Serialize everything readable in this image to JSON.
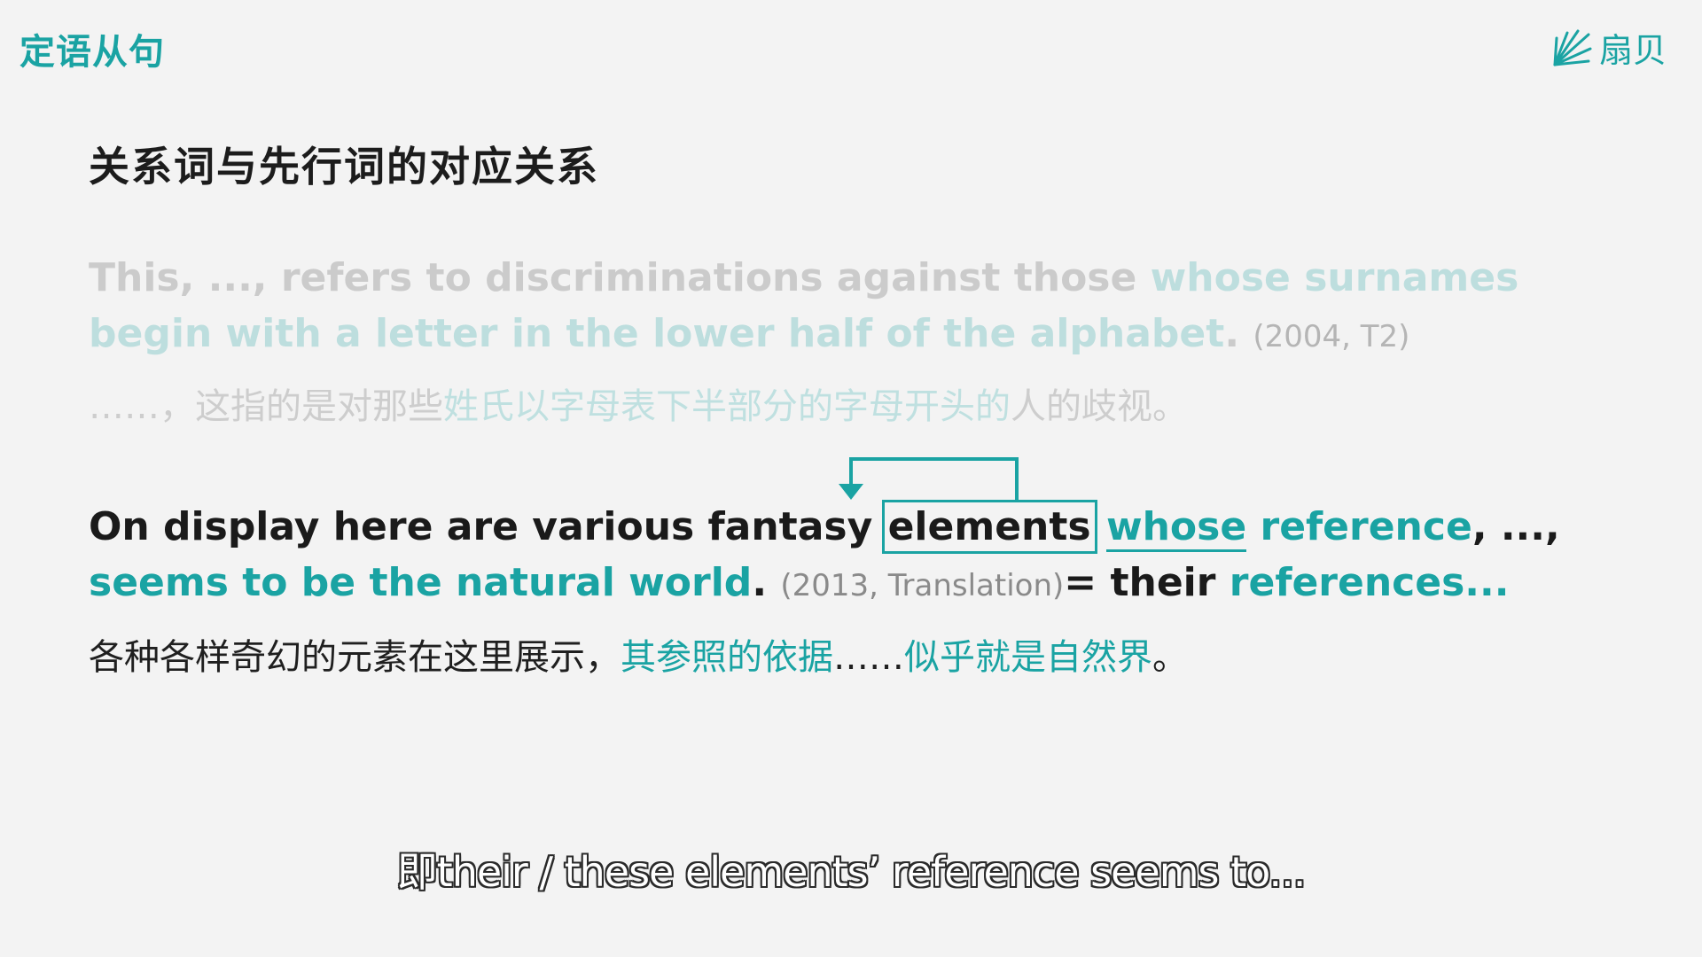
{
  "header": {
    "topic": "定语从句",
    "logo_text": "扇贝",
    "logo_icon": "shell-rays-icon"
  },
  "slide": {
    "title": "关系词与先行词的对应关系"
  },
  "example_faded": {
    "line1_plain": "This, ..., refers to discriminations against those ",
    "line1_highlight": "whose surnames",
    "line2_highlight": "begin with a letter in the lower half of the alphabet",
    "line2_end": ". ",
    "source": "(2004, T2)",
    "zh_pre": "……，这指的是对那些",
    "zh_highlight": "姓氏以字母表下半部分的字母开头的",
    "zh_post": "人的歧视。"
  },
  "example_active": {
    "line1_plain": "On display here are various fantasy ",
    "antecedent": "elements",
    "relative": "whose",
    "line1_highlight_rest": " reference",
    "line1_end": ", ...,",
    "line2_highlight": "seems to be the natural world",
    "line2_end": ". ",
    "source": "(2013, Translation)",
    "equals": "= their ",
    "equals_highlight": "references...",
    "zh_pre": "各种各样奇幻的元素在这里展示，",
    "zh_highlight1": "其参照的依据",
    "zh_mid": "……",
    "zh_highlight2": "似乎就是自然界",
    "zh_end": "。"
  },
  "subtitle": {
    "text": "即their / these elements’   reference seems to..."
  },
  "colors": {
    "accent": "#1aa3a3",
    "background": "#f3f3f3",
    "faded_text": "#cbcbcb",
    "faded_accent": "#bddede"
  }
}
